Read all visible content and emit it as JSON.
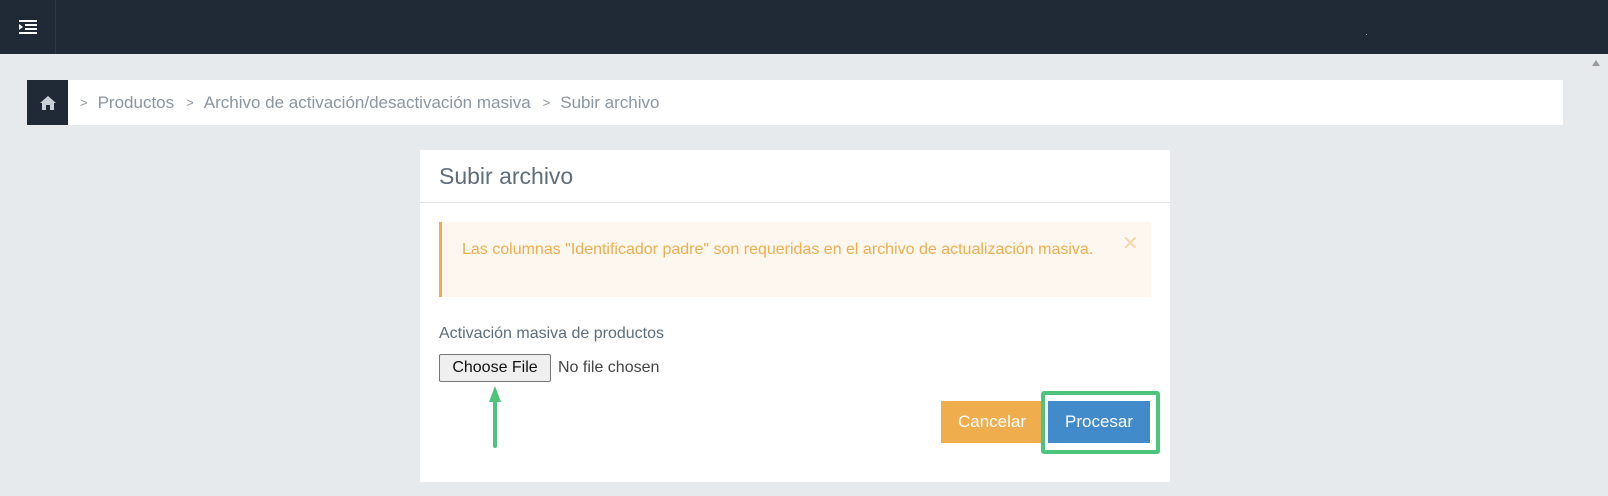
{
  "topbar": {
    "menu_icon": "list-menu-icon"
  },
  "breadcrumb": {
    "home_icon": "home-icon",
    "separator_icon": "chevron-right-icon",
    "items": [
      {
        "label": "Productos"
      },
      {
        "label": "Archivo de activación/desactivación masiva"
      },
      {
        "label": "Subir archivo"
      }
    ]
  },
  "panel": {
    "title": "Subir archivo",
    "alert": {
      "text": "Las columnas \"Identificador padre\" son requeridas en el archivo de actualización masiva.",
      "close_icon": "close-icon",
      "color": "#f0ad4e"
    },
    "field_label": "Activación masiva de productos",
    "file_button_label": "Choose File",
    "file_status": "No file chosen",
    "cancel_label": "Cancelar",
    "process_label": "Procesar"
  },
  "colors": {
    "topbar": "#1f2a36",
    "cancel": "#f0ad4e",
    "process": "#428bca",
    "highlight": "#4cc47c"
  }
}
